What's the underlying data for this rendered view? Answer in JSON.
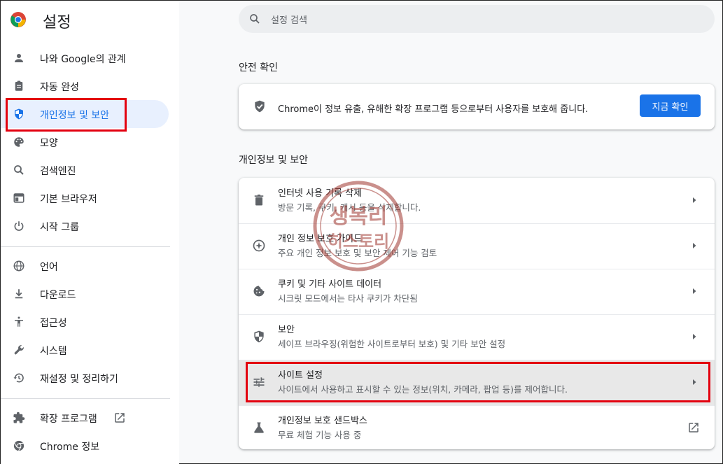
{
  "header": {
    "title": "설정"
  },
  "search": {
    "placeholder": "설정 검색"
  },
  "sidebar": {
    "items": [
      {
        "label": "나와 Google의 관계",
        "icon": "person-icon"
      },
      {
        "label": "자동 완성",
        "icon": "clipboard-icon"
      },
      {
        "label": "개인정보 및 보안",
        "icon": "shield-icon",
        "active": true
      },
      {
        "label": "모양",
        "icon": "palette-icon"
      },
      {
        "label": "검색엔진",
        "icon": "search-icon"
      },
      {
        "label": "기본 브라우저",
        "icon": "browser-icon"
      },
      {
        "label": "시작 그룹",
        "icon": "power-icon"
      },
      {
        "label": "언어",
        "icon": "globe-icon"
      },
      {
        "label": "다운로드",
        "icon": "download-icon"
      },
      {
        "label": "접근성",
        "icon": "accessibility-icon"
      },
      {
        "label": "시스템",
        "icon": "wrench-icon"
      },
      {
        "label": "재설정 및 정리하기",
        "icon": "history-icon"
      },
      {
        "label": "확장 프로그램",
        "icon": "puzzle-icon"
      },
      {
        "label": "Chrome 정보",
        "icon": "chrome-icon"
      }
    ]
  },
  "safety": {
    "title": "안전 확인",
    "text": "Chrome이 정보 유출, 유해한 확장 프로그램 등으로부터 사용자를 보호해 줍니다.",
    "button": "지금 확인"
  },
  "privacy": {
    "title": "개인정보 및 보안",
    "rows": [
      {
        "title": "인터넷 사용 기록 삭제",
        "subtitle": "방문 기록, 쿠키, 캐시 등을 삭제합니다."
      },
      {
        "title": "개인 정보 보호 가이드",
        "subtitle": "주요 개인 정보 보호 및 보안 제어 기능 검토"
      },
      {
        "title": "쿠키 및 기타 사이트 데이터",
        "subtitle": "시크릿 모드에서는 타사 쿠키가 차단됨"
      },
      {
        "title": "보안",
        "subtitle": "세이프 브라우징(위험한 사이트로부터 보호) 및 기타 보안 설정"
      },
      {
        "title": "사이트 설정",
        "subtitle": "사이트에서 사용하고 표시할 수 있는 정보(위치, 카메라, 팝업 등)를 제어합니다."
      },
      {
        "title": "개인정보 보호 샌드박스",
        "subtitle": "무료 체험 기능 사용 중"
      }
    ]
  },
  "watermark": {
    "line1": "생복리",
    "line2": "히스토리"
  },
  "colors": {
    "accent": "#1a73e8",
    "highlight": "#e3000f"
  }
}
